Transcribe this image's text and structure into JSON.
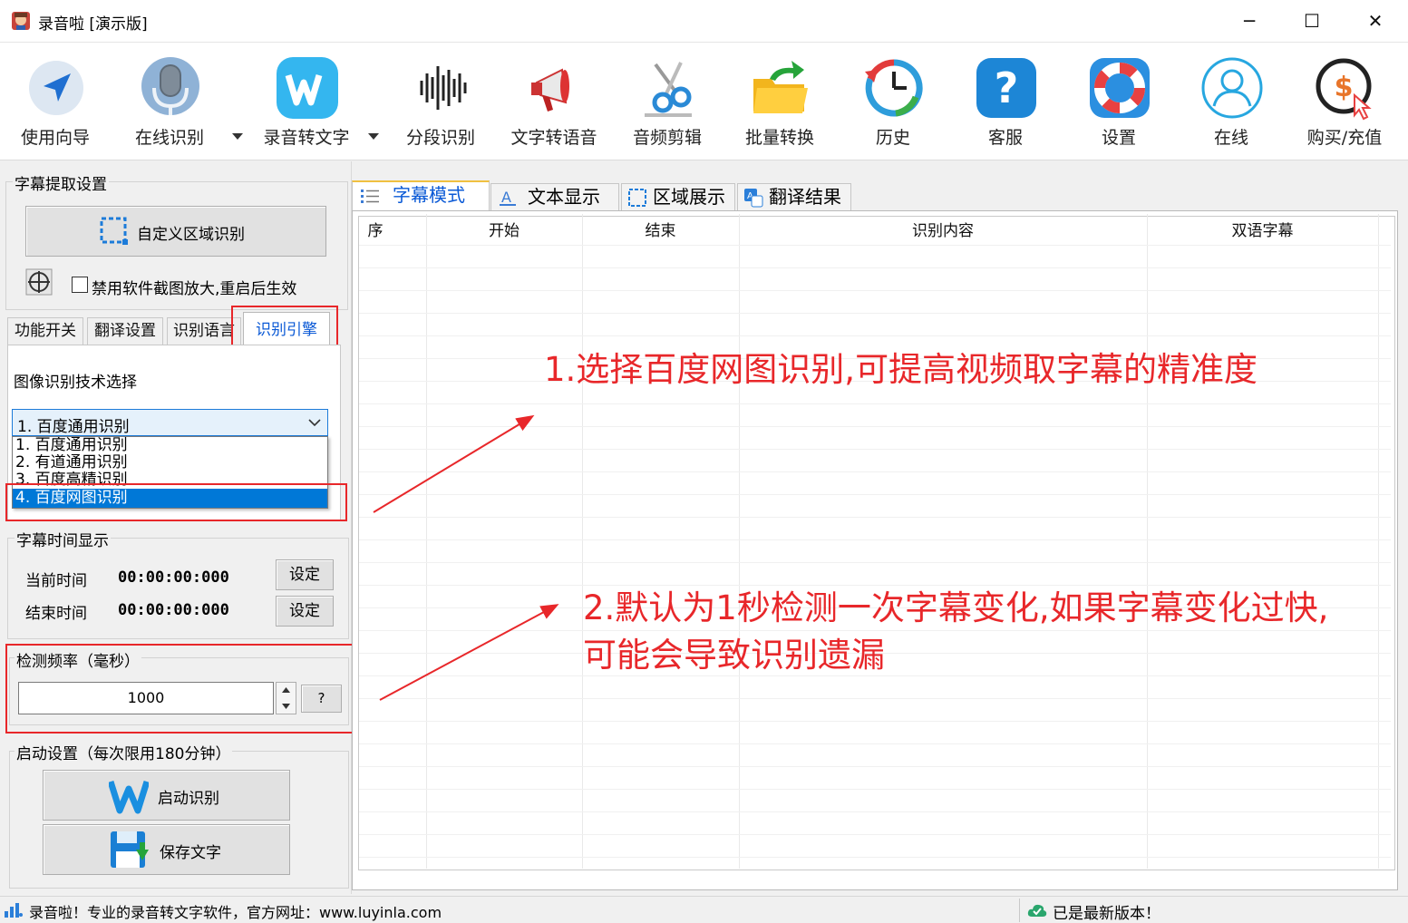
{
  "window": {
    "title": "录音啦 [演示版]",
    "minimize_glyph": "─",
    "maximize_glyph": "☐",
    "close_glyph": "✕"
  },
  "toolbar": {
    "items": [
      {
        "label": "使用向导",
        "icon": "navigation-arrow-icon"
      },
      {
        "label": "在线识别",
        "icon": "microphone-icon"
      },
      {
        "label": "录音转文字",
        "icon": "w-logo-icon"
      },
      {
        "label": "分段识别",
        "icon": "waveform-icon"
      },
      {
        "label": "文字转语音",
        "icon": "megaphone-icon"
      },
      {
        "label": "音频剪辑",
        "icon": "scissors-icon"
      },
      {
        "label": "批量转换",
        "icon": "folder-arrow-icon"
      },
      {
        "label": "历史",
        "icon": "history-clock-icon"
      },
      {
        "label": "客服",
        "icon": "help-question-icon"
      },
      {
        "label": "设置",
        "icon": "lifebuoy-icon"
      },
      {
        "label": "在线",
        "icon": "user-icon"
      },
      {
        "label": "购买/充值",
        "icon": "dollar-cursor-icon"
      }
    ]
  },
  "subtitle_settings": {
    "group_title": "字幕提取设置",
    "custom_region_button": "自定义区域识别",
    "disable_zoom_checkbox": "禁用软件截图放大,重启后生效",
    "disable_zoom_checked": false
  },
  "left_tabs": {
    "items": [
      "功能开关",
      "翻译设置",
      "识别语言",
      "识别引擎"
    ],
    "active": "识别引擎"
  },
  "engine": {
    "label": "图像识别技术选择",
    "selected": "1. 百度通用识别",
    "options": [
      "1. 百度通用识别",
      "2. 有道通用识别",
      "3. 百度高精识别",
      "4. 百度网图识别"
    ],
    "highlighted": "4. 百度网图识别"
  },
  "time_display": {
    "group_title": "字幕时间显示",
    "current_label": "当前时间",
    "current_value": "00:00:00:000",
    "end_label": "结束时间",
    "end_value": "00:00:00:000",
    "set_button": "设定"
  },
  "frequency": {
    "group_title": "检测频率（毫秒）",
    "value": "1000",
    "help_button": "?"
  },
  "startup": {
    "group_title": "启动设置（每次限用180分钟）",
    "start_button": "启动识别",
    "save_button": "保存文字"
  },
  "right_tabs": {
    "items": [
      "字幕模式",
      "文本显示",
      "区域展示",
      "翻译结果"
    ],
    "active": "字幕模式"
  },
  "table": {
    "columns": [
      "序",
      "开始",
      "结束",
      "识别内容",
      "双语字幕"
    ]
  },
  "annotations": {
    "note1": "1.选择百度网图识别,可提高视频取字幕的精准度",
    "note2_line1": "2.默认为1秒检测一次字幕变化,如果字幕变化过快,",
    "note2_line2": "可能会导致识别遗漏"
  },
  "status": {
    "left": "录音啦！专业的录音转文字软件，官方网址：www.luyinla.com",
    "right": "已是最新版本！"
  },
  "colors": {
    "annotation_red": "#e8272a",
    "selection_blue": "#0078d7",
    "active_tab_text": "#0a59d6"
  }
}
